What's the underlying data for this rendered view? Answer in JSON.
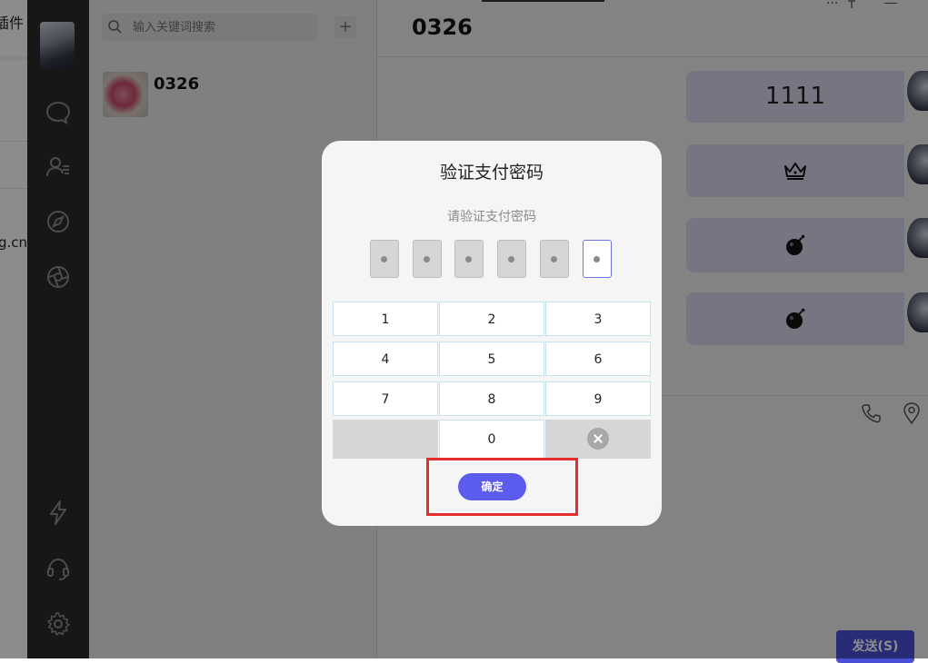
{
  "browser_fragment": {
    "top_text": "插件",
    "url_fragment": "g.cn/"
  },
  "sidebar": {
    "icons": [
      "chat-icon",
      "contacts-icon",
      "discover-icon",
      "shutter-icon",
      "lightning-icon",
      "support-icon",
      "settings-icon"
    ]
  },
  "conversation_list": {
    "search_placeholder": "输入关键词搜索",
    "add_label": "+",
    "items": [
      {
        "name": "0326"
      }
    ]
  },
  "chat": {
    "title": "0326",
    "header_more": "...",
    "messages": [
      {
        "text": "1111",
        "icon": ""
      },
      {
        "text": "",
        "icon": "crown-icon"
      },
      {
        "text": "",
        "icon": "bomb-icon"
      },
      {
        "text": "",
        "icon": "bomb-icon"
      }
    ],
    "send_label": "发送(S)"
  },
  "dialog": {
    "title": "验证支付密码",
    "subtitle": "请验证支付密码",
    "pin_length": 6,
    "keys": [
      "1",
      "2",
      "3",
      "4",
      "5",
      "6",
      "7",
      "8",
      "9",
      "",
      "0",
      "delete"
    ],
    "confirm_label": "确定"
  },
  "colors": {
    "accent": "#5b5bf0",
    "highlight": "#e52d2d",
    "sidebar": "#2a2a2a"
  }
}
